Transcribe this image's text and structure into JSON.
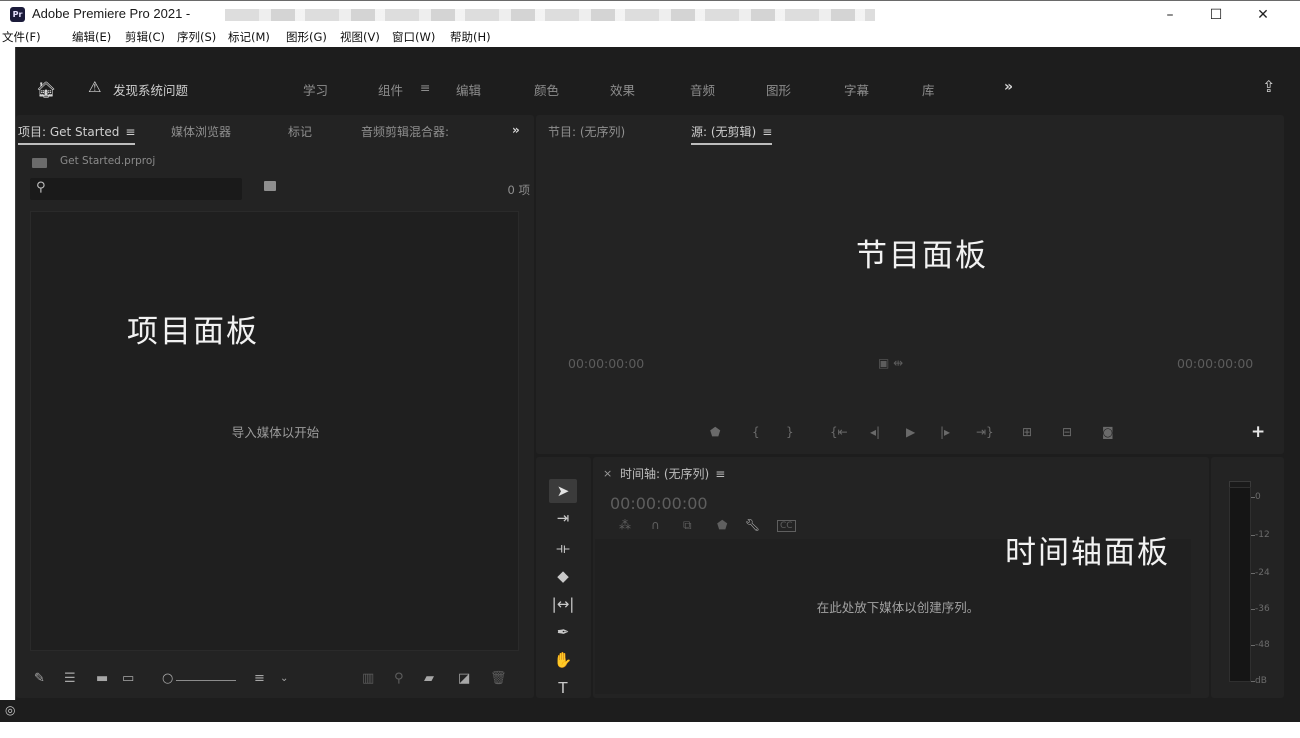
{
  "window": {
    "app_icon_text": "Pr",
    "title": "Adobe Premiere Pro 2021 -",
    "minimize": "–",
    "maximize": "☐",
    "close": "✕"
  },
  "menu": [
    "文件(F)",
    "编辑(E)",
    "剪辑(C)",
    "序列(S)",
    "标记(M)",
    "图形(G)",
    "视图(V)",
    "窗口(W)",
    "帮助(H)"
  ],
  "workspace": {
    "warning": "发现系统问题",
    "items": [
      "学习",
      "组件",
      "≡",
      "编辑",
      "颜色",
      "效果",
      "音频",
      "图形",
      "字幕",
      "库"
    ],
    "more": "»"
  },
  "project_panel": {
    "tabs": [
      "项目: Get Started",
      "媒体浏览器",
      "标记",
      "音频剪辑混合器:"
    ],
    "tab_menu": "≡",
    "more": "»",
    "file_name": "Get Started.prproj",
    "search_placeholder": "",
    "item_count": "0 项",
    "overlay_label": "项目面板",
    "import_hint": "导入媒体以开始"
  },
  "monitor_panel": {
    "tabs": [
      "节目: (无序列)",
      "源: (无剪辑)"
    ],
    "tab_menu": "≡",
    "overlay_label": "节目面板",
    "timecode_left": "00:00:00:00",
    "timecode_right": "00:00:00:00",
    "add": "+"
  },
  "timeline_panel": {
    "close": "×",
    "title": "时间轴: (无序列)",
    "tab_menu": "≡",
    "timecode": "00:00:00:00",
    "overlay_label": "时间轴面板",
    "drop_hint": "在此处放下媒体以创建序列。"
  },
  "audio_meter": {
    "labels": [
      "0",
      "-12",
      "-24",
      "-36",
      "-48",
      "dB"
    ]
  }
}
